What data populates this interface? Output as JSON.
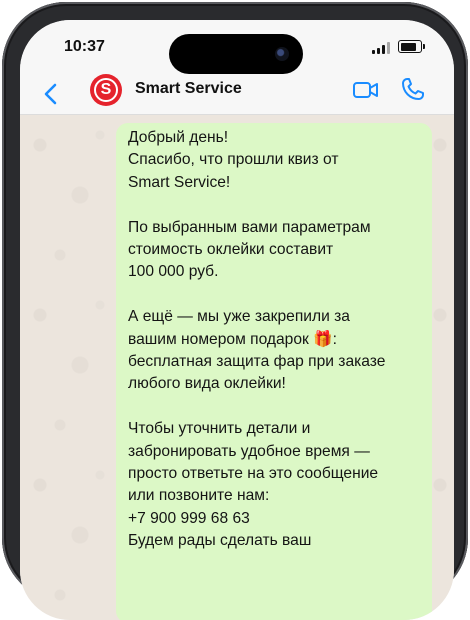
{
  "status": {
    "time": "10:37"
  },
  "header": {
    "contact_name": "Smart Service",
    "avatar_letter": "S"
  },
  "message": {
    "lines": [
      "Добрый день!",
      "Спасибо, что прошли квиз от",
      "Smart Service!",
      "",
      "По выбранным вами параметрам",
      "стоимость оклейки составит",
      "100 000 руб.",
      "",
      "А ещё — мы уже закрепили за",
      "вашим номером подарок 🎁:",
      "бесплатная защита фар при заказе",
      "любого вида оклейки!",
      "",
      "Чтобы уточнить детали и",
      "забронировать удобное время —",
      "просто ответьте на это сообщение",
      "или позвоните нам:",
      "+7 900 999 68 63",
      "Будем рады сделать ваш"
    ]
  },
  "colors": {
    "accent": "#1a8cff",
    "avatar": "#e5232c",
    "bubble": "#dcf8c6"
  }
}
